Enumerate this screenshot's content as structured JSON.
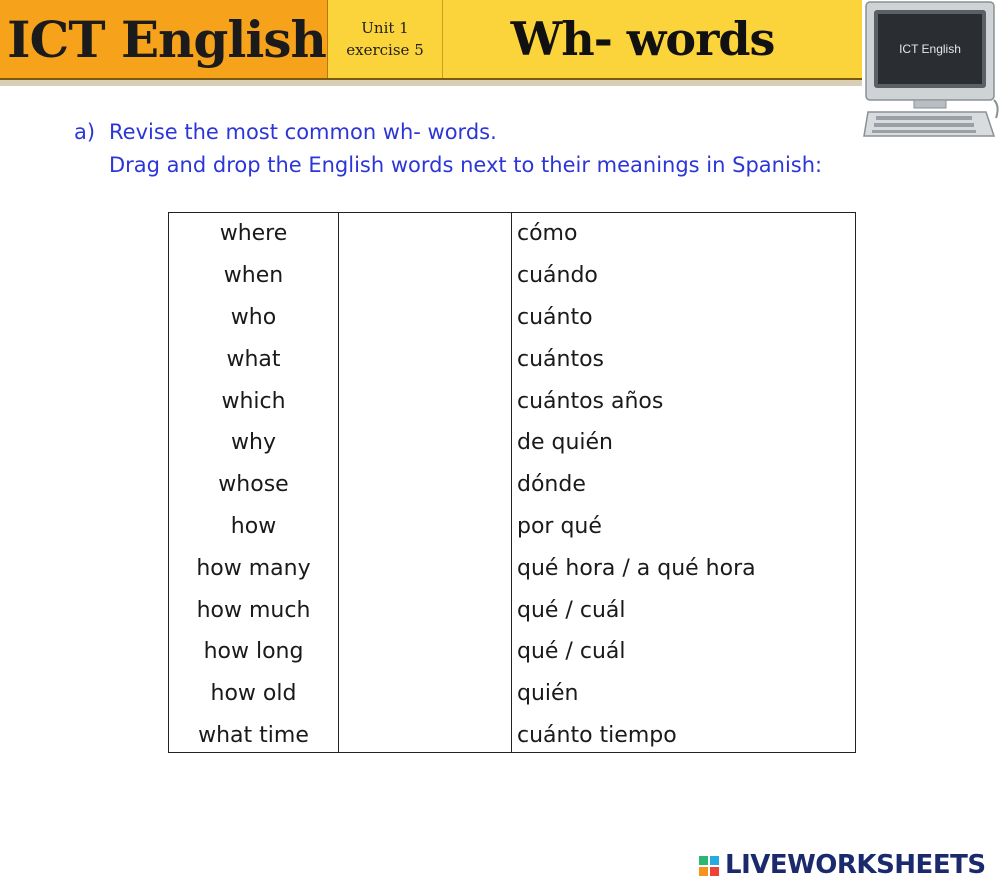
{
  "header": {
    "title": "ICT English",
    "unit": "Unit 1",
    "exercise": "exercise 5",
    "topic": "Wh- words"
  },
  "computer_image": {
    "screen_text": "ICT English"
  },
  "instructions": {
    "letter": "a)",
    "line1": "Revise the most common wh- words.",
    "line2": "Drag and drop the English words next to their meanings in Spanish:"
  },
  "table": {
    "english_words": [
      "where",
      "when",
      "who",
      "what",
      "which",
      "why",
      "whose",
      "how",
      "how many",
      "how much",
      "how long",
      "how old",
      "what time"
    ],
    "spanish_meanings": [
      "cómo",
      "cuándo",
      "cuánto",
      "cuántos",
      "cuántos años",
      "de quién",
      "dónde",
      "por qué",
      "qué hora / a qué hora",
      "qué / cuál",
      "qué / cuál",
      "quién",
      "cuánto tiempo"
    ]
  },
  "footer": {
    "brand": "LIVEWORKSHEETS"
  }
}
